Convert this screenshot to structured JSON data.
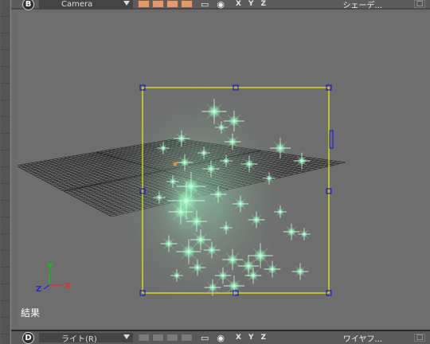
{
  "top_viewport": {
    "letter": "B",
    "camera_select": "Camera",
    "axes_buttons": [
      "X",
      "Y",
      "Z"
    ],
    "shading_label": "シェーデ...",
    "close": "□"
  },
  "bottom_viewport": {
    "letter": "D",
    "camera_select": "ライト(R)",
    "axes_buttons": [
      "X",
      "Y",
      "Z"
    ],
    "shading_label": "ワイヤフ...",
    "close": "□"
  },
  "viewport": {
    "label": "結果",
    "axis_labels": {
      "y": "Y",
      "x": "X",
      "z": "Z"
    }
  },
  "colors": {
    "selection_box": "#f0f000",
    "handle": "#2020c0",
    "grid": "#1e1e1e",
    "sparkle": "#8cf5b4",
    "axis_y": "#00cc00",
    "axis_x": "#ff2020",
    "axis_z": "#2020ff"
  }
}
